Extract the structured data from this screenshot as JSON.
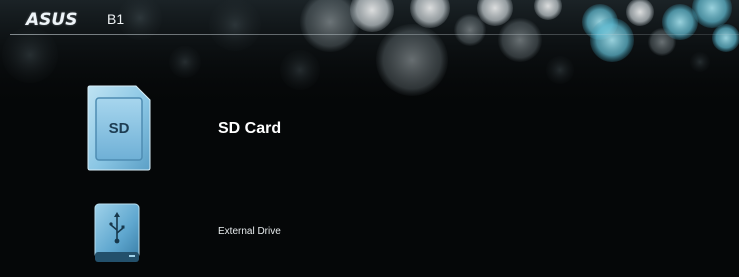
{
  "header": {
    "brand": "ASUS",
    "model": "B1"
  },
  "menu": [
    {
      "label": "SD Card",
      "icon": "sd-card-icon",
      "selected": true,
      "icon_text": "SD"
    },
    {
      "label": "External Drive",
      "icon": "usb-drive-icon",
      "selected": false
    }
  ],
  "colors": {
    "background": "#050708",
    "icon_blue": "#8cc8e6",
    "icon_blue_dark": "#3f86b0",
    "bokeh_cyan": "#66c7dc",
    "text": "#ffffff"
  }
}
